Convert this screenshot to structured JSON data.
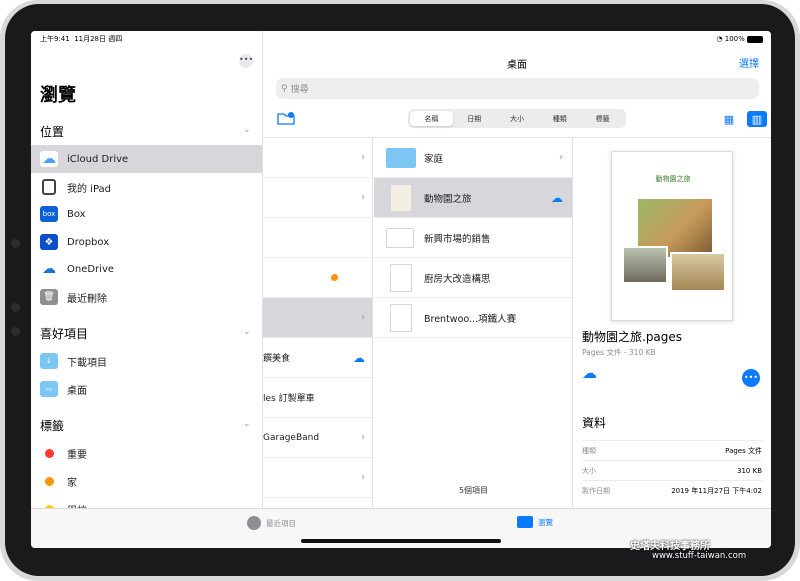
{
  "status": {
    "time": "上午9:41",
    "date": "11月28日 週四",
    "battery": "100%"
  },
  "sidebar": {
    "title": "瀏覽",
    "sections": {
      "locations": "位置",
      "favorites": "喜好項目",
      "tags": "標籤"
    },
    "locations": [
      {
        "label": "iCloud Drive",
        "icon": "icloud-icon"
      },
      {
        "label": "我的 iPad",
        "icon": "ipad-icon"
      },
      {
        "label": "Box",
        "icon": "box-icon"
      },
      {
        "label": "Dropbox",
        "icon": "dropbox-icon"
      },
      {
        "label": "OneDrive",
        "icon": "onedrive-icon"
      },
      {
        "label": "最近刪除",
        "icon": "trash-icon"
      }
    ],
    "favorites": [
      {
        "label": "下載項目",
        "icon": "downloads-folder-icon"
      },
      {
        "label": "桌面",
        "icon": "desktop-folder-icon"
      }
    ],
    "tags": [
      {
        "label": "重要",
        "color": "#ff3b30"
      },
      {
        "label": "家",
        "color": "#ff9500"
      },
      {
        "label": "學校",
        "color": "#ffcc00"
      }
    ]
  },
  "main": {
    "title": "桌面",
    "select": "選擇",
    "search_placeholder": "搜尋",
    "sort": [
      "名稱",
      "日期",
      "大小",
      "種類",
      "標籤"
    ],
    "col1": [
      "",
      "",
      "",
      "",
      "",
      "饌美食",
      "les 訂製單車",
      "GarageBand",
      "",
      ""
    ],
    "col2": [
      {
        "name": "家庭"
      },
      {
        "name": "動物園之旅"
      },
      {
        "name": "新興市場的銷售"
      },
      {
        "name": "廚房大改造構思"
      },
      {
        "name": "Brentwoo...項鐵人賽"
      }
    ],
    "count": "5個項目"
  },
  "preview": {
    "doc_title": "動物園之旅",
    "name": "動物園之旅.pages",
    "sub": "Pages 文件 - 310 KB",
    "info_title": "資料",
    "info": [
      {
        "k": "種類",
        "v": "Pages 文件"
      },
      {
        "k": "大小",
        "v": "310 KB"
      },
      {
        "k": "製作日期",
        "v": "2019 年11月27日 下午4:02"
      }
    ]
  },
  "tabs": {
    "recent": "最近項目",
    "browse": "瀏覽"
  },
  "watermark": {
    "line1": "史塔夫科技事務所",
    "line2": "www.stuff-taiwan.com"
  },
  "colors": {
    "accent": "#0a7aff",
    "selected": "#d6d6db"
  }
}
